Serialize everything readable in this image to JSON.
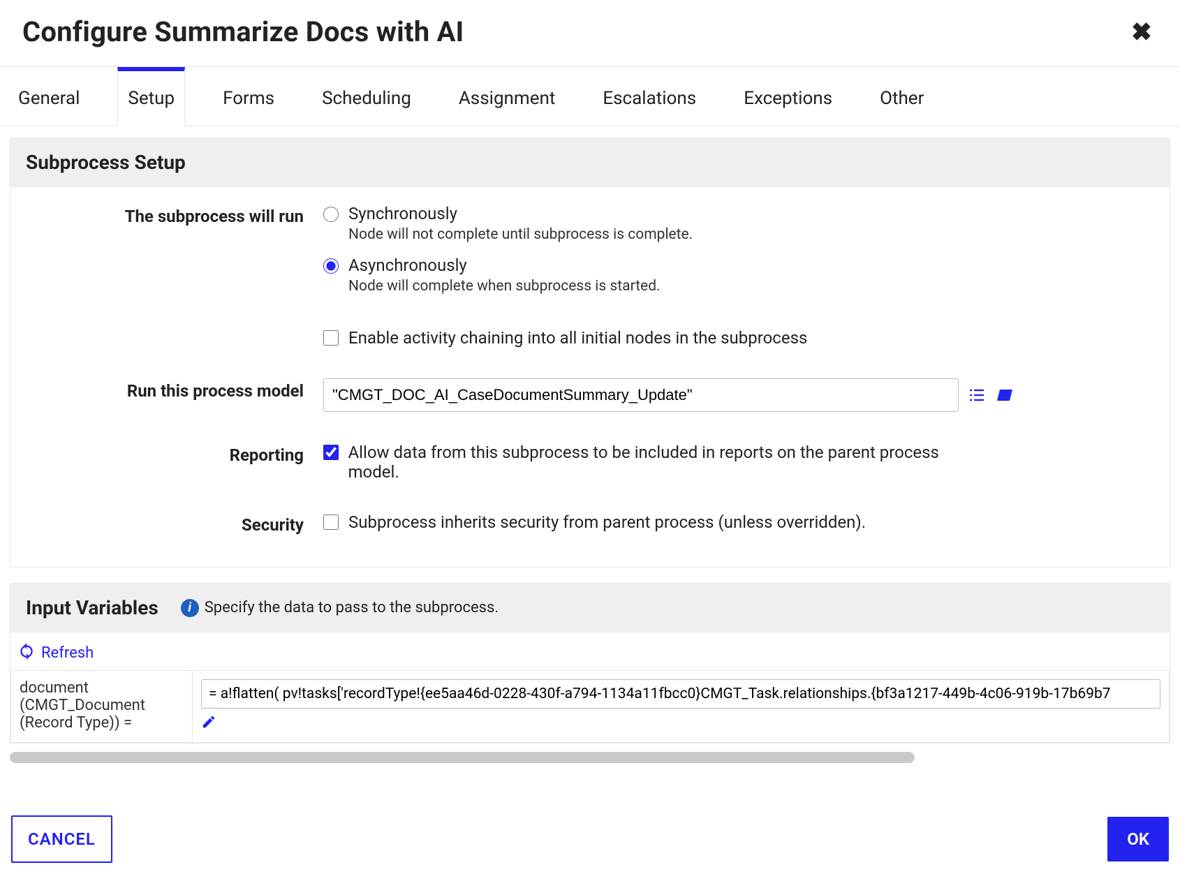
{
  "title": "Configure Summarize Docs with AI",
  "tabs": [
    "General",
    "Setup",
    "Forms",
    "Scheduling",
    "Assignment",
    "Escalations",
    "Exceptions",
    "Other"
  ],
  "active_tab_index": 1,
  "subprocess": {
    "section_title": "Subprocess Setup",
    "run_label": "The subprocess will run",
    "sync": {
      "label": "Synchronously",
      "hint": "Node will not complete until subprocess is complete."
    },
    "async": {
      "label": "Asynchronously",
      "hint": "Node will complete when subprocess is started."
    },
    "selected": "async",
    "chaining": {
      "label": "Enable activity chaining into all initial nodes in the subprocess",
      "checked": false
    },
    "model_label": "Run this process model",
    "model_value": "\"CMGT_DOC_AI_CaseDocumentSummary_Update\"",
    "reporting_label": "Reporting",
    "reporting_text": "Allow data from this subprocess to be included in reports on the parent process model.",
    "reporting_checked": true,
    "security_label": "Security",
    "security_text": "Subprocess inherits security from parent process (unless overridden).",
    "security_checked": false
  },
  "input_variables": {
    "section_title": "Input Variables",
    "help_text": "Specify the data to pass to the subprocess.",
    "refresh": "Refresh",
    "rows": [
      {
        "name": "document (CMGT_Document (Record Type)) =",
        "value": "= a!flatten( pv!tasks['recordType!{ee5aa46d-0228-430f-a794-1134a11fbcc0}CMGT_Task.relationships.{bf3a1217-449b-4c06-919b-17b69b7"
      }
    ]
  },
  "footer": {
    "cancel": "CANCEL",
    "ok": "OK"
  }
}
